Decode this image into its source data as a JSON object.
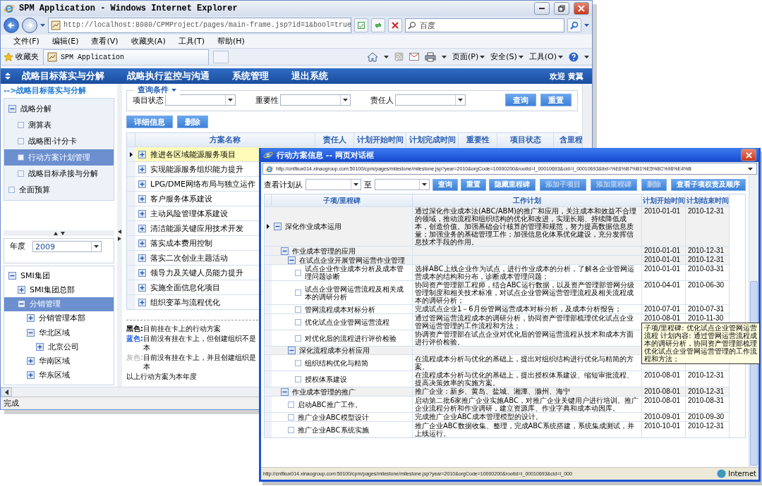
{
  "window": {
    "title": "SPM Application - Windows Internet Explorer"
  },
  "browser": {
    "address": "http://localhost:8080/CPMProject/pages/main-frame.jsp?id=1&bool=true",
    "search_placeholder": "百度",
    "menu": [
      "文件(F)",
      "编辑(E)",
      "查看(V)",
      "收藏夹(A)",
      "工具(T)",
      "帮助(H)"
    ],
    "favorites": "收藏夹",
    "tab": "SPM Application",
    "commands": [
      "页面(P)",
      "安全(S)",
      "工具(O)"
    ]
  },
  "nav": {
    "items": [
      "战略目标落实与分解",
      "战略执行监控与沟通",
      "系统管理",
      "退出系统"
    ],
    "welcome": "欢迎",
    "user": "黄翼"
  },
  "breadcrumb": "-->战略目标落实与分解",
  "sidebar": {
    "items": [
      {
        "label": "战略分解",
        "expanded": true,
        "selected": false,
        "children": [
          {
            "label": "测算表",
            "selected": false
          },
          {
            "label": "战略图·计分卡",
            "selected": false
          },
          {
            "label": "行动方案计划管理",
            "selected": true
          },
          {
            "label": "战略目标承接与分解",
            "selected": false
          }
        ]
      },
      {
        "label": "全面预算",
        "selected": false
      }
    ]
  },
  "year": {
    "label": "年度",
    "value": "2009"
  },
  "org_tree": {
    "nodes": [
      {
        "label": "SMI集团",
        "expanded": true,
        "selected": false,
        "children": [
          {
            "label": "SMI集团总部",
            "expanded": false,
            "selected": false
          },
          {
            "label": "分销管理",
            "expanded": true,
            "selected": true,
            "children": [
              {
                "label": "分销管理本部",
                "expanded": false,
                "selected": false
              },
              {
                "label": "华北区域",
                "expanded": true,
                "selected": false,
                "children": [
                  {
                    "label": "北京公司",
                    "expanded": false,
                    "selected": false
                  }
                ]
              },
              {
                "label": "华南区域",
                "expanded": false,
                "selected": false
              },
              {
                "label": "华东区域",
                "expanded": false,
                "selected": false
              }
            ]
          }
        ]
      }
    ]
  },
  "query": {
    "title": "查询条件",
    "fields": [
      {
        "label": "项目状态"
      },
      {
        "label": "重要性"
      },
      {
        "label": "责任人"
      }
    ],
    "buttons": [
      "查询",
      "重置"
    ]
  },
  "actions": [
    "详细信息",
    "删除"
  ],
  "table": {
    "columns": [
      "方案名称",
      "责任人",
      "计划开始时间",
      "计划完成时间",
      "重要性",
      "项目状态",
      "含里程"
    ],
    "rows": [
      {
        "name": "推进各区域能源服务项目",
        "selected": true
      },
      {
        "name": "实现能源服务组织能力提升",
        "selected": false
      },
      {
        "name": "LPG/DME网络布局与独立运作",
        "selected": false
      },
      {
        "name": "客户服务体系建设",
        "selected": false
      },
      {
        "name": "主动风险管理体系建设",
        "selected": false
      },
      {
        "name": "清洁能源关键应用技术开发",
        "selected": false
      },
      {
        "name": "落实成本费用控制",
        "selected": false
      },
      {
        "name": "落实二次创业主题活动",
        "selected": false
      },
      {
        "name": "领导力及关键人员能力提升",
        "selected": false
      },
      {
        "name": "实施全面信息化项目",
        "selected": false
      },
      {
        "name": "组织变革与流程优化",
        "selected": false
      }
    ]
  },
  "legend": {
    "items": [
      {
        "label": "黑色:",
        "color": "#000000",
        "text": "目前挂在卡上的行动方案"
      },
      {
        "label": "蓝色:",
        "color": "#1e5ee8",
        "text": "目前没有挂在卡上，但创建组织不是本"
      },
      {
        "label": "灰色:",
        "color": "#c0c0c0",
        "text": "目前没有挂在卡上，并且创建组织是本"
      }
    ],
    "note": "以上行动方案为本年度"
  },
  "status_bar": "完成",
  "popup": {
    "title": "行动方案信息 -- 网页对话框",
    "address": "http://cnlfkux014.xinaogroup.com:50100/cpm/pages/milestone/milestone.jsp?year=2010&orgCode=10000200&rootId=I_00010693&cid=I_00010693&ltxt=%E6%B7%B1%E5%8C%96%E4%B",
    "filter": {
      "from_label": "查看计划从",
      "to_label": "至",
      "buttons": [
        {
          "label": "查询",
          "disabled": false
        },
        {
          "label": "重置",
          "disabled": false
        }
      ]
    },
    "tools": [
      {
        "label": "隐藏里程碑",
        "disabled": false
      },
      {
        "label": "添加子项目",
        "disabled": true
      },
      {
        "label": "添加里程碑",
        "disabled": true
      },
      {
        "label": "删除",
        "disabled": true
      },
      {
        "label": "查看子项权责及顺序",
        "disabled": false
      }
    ],
    "columns": [
      "子项/里程碑",
      "工作计划",
      "计划开始时间",
      "计划结束时间"
    ],
    "rows": [
      {
        "name": "深化作业成本运用",
        "plan": "通过深化作业成本法(ABC/ABM)的推广和应用，关注成本和效益不合理的领域，推动流程和组织结构的优化和改进，实现长期、持续降低成本，创造价值。加强基础会计核算的管理和规范，努力提高数据信息质量；加强业务的基础管理工作；加强信息化体系优化建设，充分发挥信息技术手段的作用。",
        "start": "2010-01-01",
        "end": "2010-12-31",
        "expanded": true,
        "selected": true,
        "children": [
          {
            "name": "作业成本管理的应用",
            "start": "2010-01-01",
            "end": "2010-12-31",
            "expanded": true,
            "selected": false,
            "children": [
              {
                "name": "在试点企业开展管网运营作业管理",
                "start": "2010-01-01",
                "end": "2010-12-31",
                "expanded": true,
                "selected": false,
                "children": [
                  {
                    "name": "试点企业作业成本分析及成本管理问题诊断",
                    "plan": "选择ABC上线企业作为试点，进行作业成本的分析，了解各企业管网运营成本的结构和分布，诊断成本管理问题；",
                    "start": "2010-01-01",
                    "end": "2010-03-31",
                    "selected": false
                  },
                  {
                    "name": "试点企业管网运营流程及相关成本的调研分析",
                    "plan": "协同资产管理部工程师，结合ABC运行数据，以及资产管理部管网分级管理制度和相关技术标准，对试点企业管网运营管理流程及相关流程成本的调研分析；",
                    "start": "2010-04-01",
                    "end": "2010-06-30",
                    "selected": false
                  },
                  {
                    "name": "管网流程成本对标分析",
                    "plan": "完成试点企业1－6月份管网运营成本对标分析，及成本分析报告；",
                    "start": "2010-07-01",
                    "end": "2010-07-31",
                    "selected": false
                  },
                  {
                    "name": "优化试点企业管网运营流程",
                    "plan": "通过管网运营流程成本的调研分析，协同资产管理部梳理优化试点企业管网运营管理的工作流程和方法；",
                    "start": "2010-08-01",
                    "end": "2010-11-30",
                    "selected": false,
                    "tooltip": "子项/里程碑: 优化试点企业管网运营流程 计划内容: 通过管网运营流程成本的调研分析，协同资产管理部梳理优化试点企业管网运营管理的工作流程和方法；"
                  },
                  {
                    "name": "对优化后的流程进行评价检验",
                    "plan": "协调资产管理部在试点企业对优化后的管网运营流程从技术和成本方面进行评价检验。",
                    "selected": false
                  }
                ]
              },
              {
                "name": "深化流程成本分析应用",
                "expanded": true,
                "selected": false,
                "children": [
                  {
                    "name": "组织结构优化与精简",
                    "plan": "在流程成本分析与优化的基础上，提出对组织结构进行优化与精简的方案。",
                    "selected": false
                  },
                  {
                    "name": "授权体系建设",
                    "plan": "在流程成本分析与优化的基础上，提出授权体系建设、缩短审批流程、提高决策效率的实施方案。",
                    "start": "2010-08-01",
                    "end": "2010-12-31",
                    "selected": false
                  }
                ]
              }
            ]
          },
          {
            "name": "作业成本管理的推广",
            "plan": "推广企业：新乡、黄岛、盐城、湘潭、滁州、海宁",
            "start": "2010-08-01",
            "end": "2010-12-31",
            "expanded": true,
            "selected": false,
            "children": [
              {
                "name": "启动ABC推广工作。",
                "plan": "启动第二批6家推广企业实施ABC，对推广企业关键用户进行培训。推广企业流程分析和作业调研，建立资源库、作业字典和成本动因库。",
                "start": "2010-08-01",
                "end": "2010-08-31",
                "selected": false
              },
              {
                "name": "推广企业ABC模型设计",
                "plan": "完成推广企业ABC成本管理模型的设计。",
                "start": "2010-09-01",
                "end": "2010-09-30",
                "selected": false
              },
              {
                "name": "推广企业ABC系统实施",
                "plan": "推广企业ABC数据收集、整理，完成ABC系统搭建，系统集成测试，并上线运行。",
                "start": "2010-10-01",
                "end": "2010-12-31",
                "selected": false
              }
            ]
          }
        ]
      }
    ],
    "status": {
      "url": "http://cnlfkux014.xinaogroup.com:50100/cpm/pages/milestone/milestone.jsp?year=2010&orgCode=10000200&rootId=I_00010693&cid=I_000",
      "zone": "Internet"
    }
  }
}
